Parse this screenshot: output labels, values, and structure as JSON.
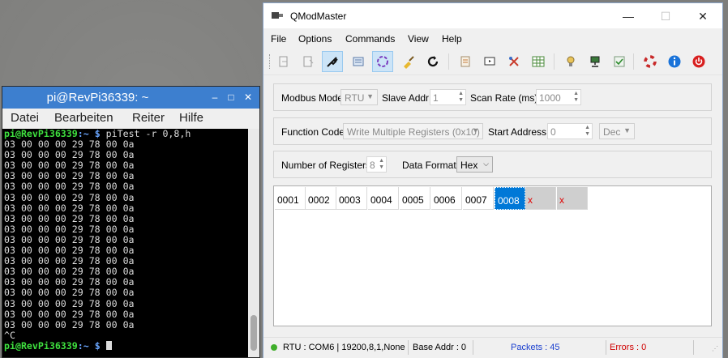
{
  "terminal": {
    "title": "pi@RevPi36339: ~",
    "controls": {
      "minimize": "–",
      "maximize": "□",
      "close": "✕"
    },
    "menu": [
      "Datei",
      "Bearbeiten",
      "Reiter",
      "Hilfe"
    ],
    "prompt_user": "pi@RevPi36339",
    "prompt_path": ":~ $",
    "command": " piTest -r 0,8,h",
    "output_lines": [
      "03 00 00 00 29 78 00 0a",
      "03 00 00 00 29 78 00 0a",
      "03 00 00 00 29 78 00 0a",
      "03 00 00 00 29 78 00 0a",
      "03 00 00 00 29 78 00 0a",
      "03 00 00 00 29 78 00 0a",
      "03 00 00 00 29 78 00 0a",
      "03 00 00 00 29 78 00 0a",
      "03 00 00 00 29 78 00 0a",
      "03 00 00 00 29 78 00 0a",
      "03 00 00 00 29 78 00 0a",
      "03 00 00 00 29 78 00 0a",
      "03 00 00 00 29 78 00 0a",
      "03 00 00 00 29 78 00 0a",
      "03 00 00 00 29 78 00 0a",
      "03 00 00 00 29 78 00 0a",
      "03 00 00 00 29 78 00 0a",
      "03 00 00 00 29 78 00 0a"
    ],
    "interrupt": "^C"
  },
  "qmm": {
    "title": "QModMaster",
    "window_controls": {
      "minimize": "—",
      "maximize": "☐",
      "close": "✕"
    },
    "menu": [
      "File",
      "Options",
      "Commands",
      "View",
      "Help"
    ],
    "toolbar_icons": [
      "connect-icon",
      "disconnect-icon",
      "serial-connect-icon",
      "tcp-connect-icon",
      "scan-icon",
      "clear-icon",
      "refresh-icon",
      "log-icon",
      "bus-monitor-icon",
      "tools-icon",
      "table-icon",
      "plugin-icon",
      "network-icon",
      "checkbox-icon",
      "help-lifebuoy-icon",
      "info-icon",
      "exit-icon"
    ],
    "modbus_mode": {
      "label": "Modbus Mode",
      "value": "RTU"
    },
    "slave_addr": {
      "label": "Slave Addr",
      "value": "1"
    },
    "scan_rate": {
      "label": "Scan Rate (ms)",
      "value": "1000"
    },
    "function_code": {
      "label": "Function Code",
      "value": "Write Multiple Registers (0x10)"
    },
    "start_address": {
      "label": "Start Address",
      "value": "0",
      "format": "Dec"
    },
    "num_registers": {
      "label": "Number of Registers",
      "value": "8"
    },
    "data_format": {
      "label": "Data Format",
      "value": "Hex"
    },
    "registers": [
      "0001",
      "0002",
      "0003",
      "0004",
      "0005",
      "0006",
      "0007",
      "0008"
    ],
    "error_marks": [
      "x",
      "x"
    ],
    "status": {
      "connection": "RTU : COM6 | 19200,8,1,None",
      "base_addr": "Base Addr : 0",
      "packets": "Packets : 45",
      "errors": "Errors : 0"
    },
    "colors": {
      "selection": "#0078d7",
      "packets": "#1a3fcf",
      "errors": "#d00000",
      "led": "#3fae2a"
    }
  }
}
